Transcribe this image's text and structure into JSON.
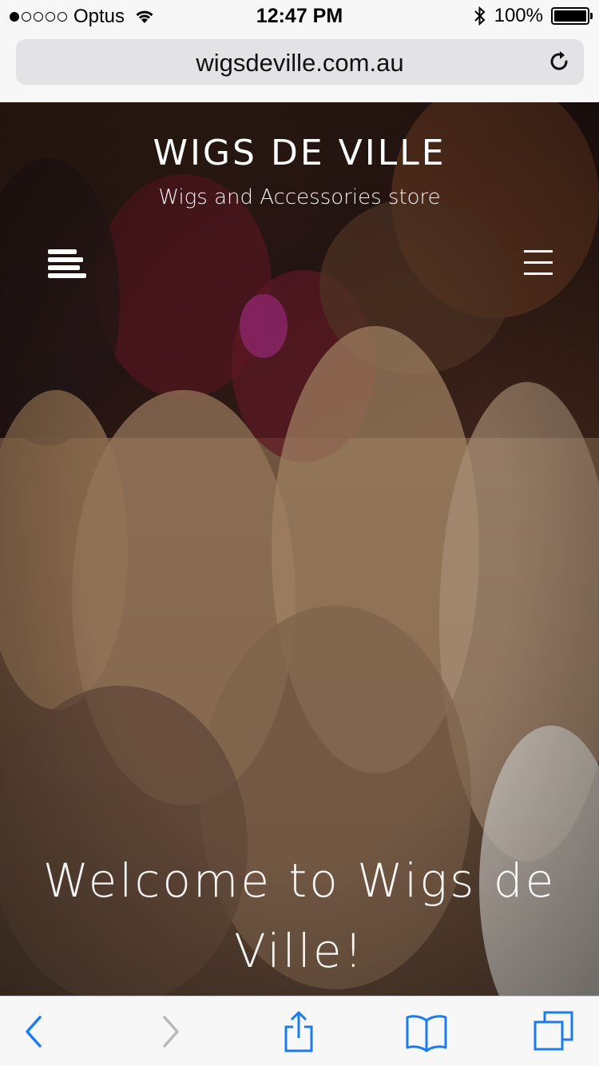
{
  "status_bar": {
    "carrier": "Optus",
    "time": "12:47 PM",
    "battery": "100%"
  },
  "browser": {
    "url": "wigsdeville.com.au"
  },
  "site": {
    "title": "WIGS DE VILLE",
    "subtitle": "Wigs and Accessories store",
    "welcome": "Welcome to Wigs de Ville!"
  },
  "icons": {
    "reload": "reload-icon",
    "align": "text-align-icon",
    "menu": "hamburger-menu-icon",
    "back": "back-icon",
    "forward": "forward-icon",
    "share": "share-icon",
    "bookmarks": "bookmarks-icon",
    "tabs": "tabs-icon"
  },
  "colors": {
    "ios_blue": "#1a7cf0",
    "disabled_gray": "#b9b9bd"
  }
}
